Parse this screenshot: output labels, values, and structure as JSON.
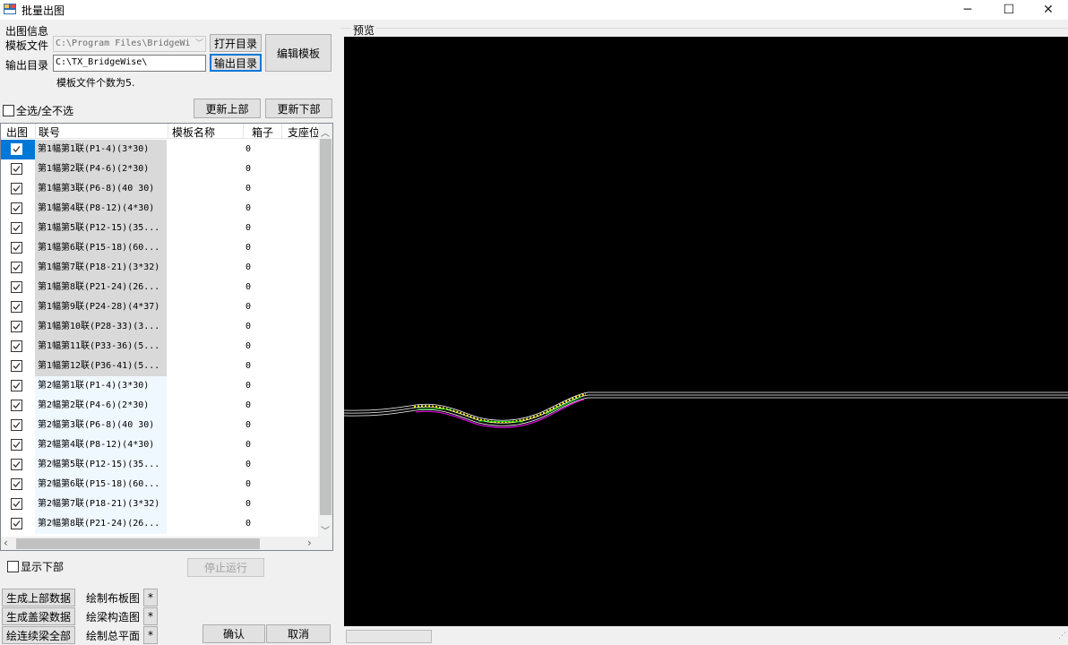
{
  "window": {
    "title": "批量出图",
    "minimize_glyph": "─",
    "maximize_glyph": "☐",
    "close_glyph": "✕"
  },
  "info": {
    "group_label": "出图信息",
    "template_label": "模板文件",
    "template_value": "C:\\Program Files\\BridgeWi",
    "open_dir_button": "打开目录",
    "output_label": "输出目录",
    "output_value": "C:\\TX_BridgeWise\\",
    "output_dir_button": "输出目录",
    "edit_template_button": "编辑模板",
    "template_count": "模板文件个数为5."
  },
  "select_all_label": "全选/全不选",
  "update_upper_button": "更新上部",
  "update_lower_button": "更新下部",
  "grid": {
    "columns": [
      "出图",
      "联号",
      "模板名称",
      "箱子",
      "支座位"
    ],
    "rows": [
      {
        "name": "第1幅第1联(P1-4)(3*30)",
        "box": "0",
        "checked": true,
        "selected": true
      },
      {
        "name": "第1幅第2联(P4-6)(2*30)",
        "box": "0",
        "checked": true
      },
      {
        "name": "第1幅第3联(P6-8)(40 30)",
        "box": "0",
        "checked": true
      },
      {
        "name": "第1幅第4联(P8-12)(4*30)",
        "box": "0",
        "checked": true
      },
      {
        "name": "第1幅第5联(P12-15)(35...",
        "box": "0",
        "checked": true
      },
      {
        "name": "第1幅第6联(P15-18)(60...",
        "box": "0",
        "checked": true
      },
      {
        "name": "第1幅第7联(P18-21)(3*32)",
        "box": "0",
        "checked": true
      },
      {
        "name": "第1幅第8联(P21-24)(26...",
        "box": "0",
        "checked": true
      },
      {
        "name": "第1幅第9联(P24-28)(4*37)",
        "box": "0",
        "checked": true
      },
      {
        "name": "第1幅第10联(P28-33)(3...",
        "box": "0",
        "checked": true
      },
      {
        "name": "第1幅第11联(P33-36)(5...",
        "box": "0",
        "checked": true
      },
      {
        "name": "第1幅第12联(P36-41)(5...",
        "box": "0",
        "checked": true
      },
      {
        "name": "第2幅第1联(P1-4)(3*30)",
        "box": "0",
        "checked": true
      },
      {
        "name": "第2幅第2联(P4-6)(2*30)",
        "box": "0",
        "checked": true
      },
      {
        "name": "第2幅第3联(P6-8)(40 30)",
        "box": "0",
        "checked": true
      },
      {
        "name": "第2幅第4联(P8-12)(4*30)",
        "box": "0",
        "checked": true
      },
      {
        "name": "第2幅第5联(P12-15)(35...",
        "box": "0",
        "checked": true
      },
      {
        "name": "第2幅第6联(P15-18)(60...",
        "box": "0",
        "checked": true
      },
      {
        "name": "第2幅第7联(P18-21)(3*32)",
        "box": "0",
        "checked": true
      },
      {
        "name": "第2幅第8联(P21-24)(26...",
        "box": "0",
        "checked": true
      }
    ],
    "row_colors": {
      "group1": "#d9d9d9",
      "group2": "#f0f8ff",
      "selection": "#0078d7"
    }
  },
  "show_lower_label": "显示下部",
  "stop_button": "停止运行",
  "actions": {
    "gen_upper": "生成上部数据",
    "gen_cap": "生成盖梁数据",
    "draw_all": "绘连续梁全部",
    "draw_layout_label": "绘制布板图",
    "draw_struct_label": "绘梁构造图",
    "draw_plan_label": "绘制总平面",
    "star": "*",
    "confirm": "确认",
    "cancel": "取消"
  },
  "preview": {
    "label": "预览",
    "background": "#000000",
    "line_color": "#ffffff",
    "accent_colors": [
      "#ffff00",
      "#ff00ff",
      "#00ff00"
    ]
  }
}
